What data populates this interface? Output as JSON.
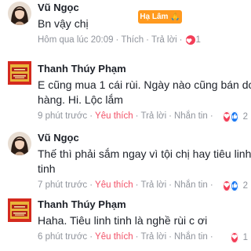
{
  "comments": [
    {
      "name": "Vũ Ngọc",
      "text": "Bn vậy chị",
      "time": "Hôm qua lúc 20:09",
      "like": "Thích",
      "reply": "Trả lời",
      "reaction_count": "1",
      "sticker": "Hạ Lâm 🙏"
    },
    {
      "name": "Thanh Thúy Phạm",
      "text_line1": "E cũng mua 1 cái rùi. Ngày nào cũng bán dc",
      "text_line2": "hàng. Hi. Lộc lắm",
      "time": "9 phút trước",
      "like": "Yêu thích",
      "reply": "Trả lời",
      "message": "Nhắn tin",
      "reaction_count": "2"
    },
    {
      "name": "Vũ Ngọc",
      "text_line1": "Thế thì phải sắm ngay vì tội chị hay tiêu linh",
      "text_line2": "tinh",
      "time": "7 phút trước",
      "like": "Yêu thích",
      "reply": "Trả lời",
      "message": "Nhắn tin",
      "reaction_count": "2"
    },
    {
      "name": "Thanh Thúy Phạm",
      "text": "Haha. Tiêu linh tinh là nghề rùi c ơi",
      "time": "6 phút trước",
      "like": "Yêu thích",
      "reply": "Trả lời",
      "message": "Nhắn tin",
      "reaction_count": "1"
    }
  ],
  "colors": {
    "meta": "#90949c",
    "love": "#f25268",
    "heart_icon": "#f33e58",
    "like_icon": "#1877f2",
    "sticker": "#ff9a1f"
  },
  "icons": [
    "heart-reaction-icon",
    "like-reaction-icon",
    "vu-ngoc-avatar",
    "thanh-thuy-pham-avatar"
  ]
}
